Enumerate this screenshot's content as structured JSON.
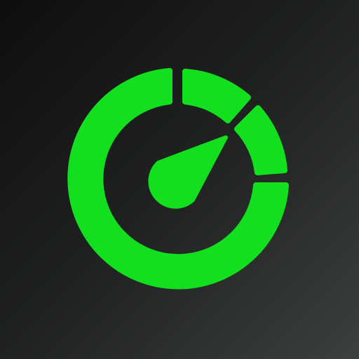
{
  "icon": {
    "name": "speedometer-gauge-app-icon",
    "colors": {
      "accent": "#12e01e",
      "background_dark": "#0f0f0f",
      "background_light": "#3a3d3b"
    }
  }
}
